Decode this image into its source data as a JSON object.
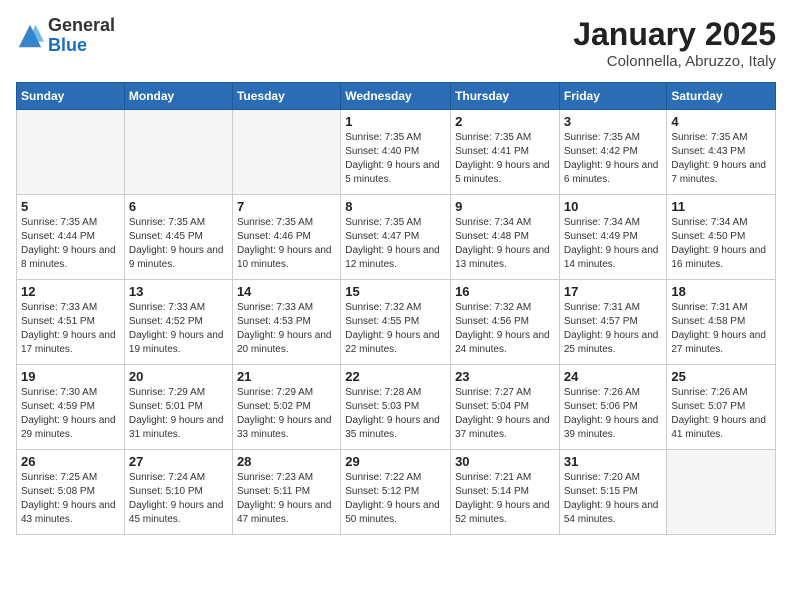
{
  "header": {
    "logo_general": "General",
    "logo_blue": "Blue",
    "month_title": "January 2025",
    "subtitle": "Colonnella, Abruzzo, Italy"
  },
  "days_of_week": [
    "Sunday",
    "Monday",
    "Tuesday",
    "Wednesday",
    "Thursday",
    "Friday",
    "Saturday"
  ],
  "weeks": [
    [
      {
        "day": "",
        "info": ""
      },
      {
        "day": "",
        "info": ""
      },
      {
        "day": "",
        "info": ""
      },
      {
        "day": "1",
        "info": "Sunrise: 7:35 AM\nSunset: 4:40 PM\nDaylight: 9 hours\nand 5 minutes."
      },
      {
        "day": "2",
        "info": "Sunrise: 7:35 AM\nSunset: 4:41 PM\nDaylight: 9 hours\nand 5 minutes."
      },
      {
        "day": "3",
        "info": "Sunrise: 7:35 AM\nSunset: 4:42 PM\nDaylight: 9 hours\nand 6 minutes."
      },
      {
        "day": "4",
        "info": "Sunrise: 7:35 AM\nSunset: 4:43 PM\nDaylight: 9 hours\nand 7 minutes."
      }
    ],
    [
      {
        "day": "5",
        "info": "Sunrise: 7:35 AM\nSunset: 4:44 PM\nDaylight: 9 hours\nand 8 minutes."
      },
      {
        "day": "6",
        "info": "Sunrise: 7:35 AM\nSunset: 4:45 PM\nDaylight: 9 hours\nand 9 minutes."
      },
      {
        "day": "7",
        "info": "Sunrise: 7:35 AM\nSunset: 4:46 PM\nDaylight: 9 hours\nand 10 minutes."
      },
      {
        "day": "8",
        "info": "Sunrise: 7:35 AM\nSunset: 4:47 PM\nDaylight: 9 hours\nand 12 minutes."
      },
      {
        "day": "9",
        "info": "Sunrise: 7:34 AM\nSunset: 4:48 PM\nDaylight: 9 hours\nand 13 minutes."
      },
      {
        "day": "10",
        "info": "Sunrise: 7:34 AM\nSunset: 4:49 PM\nDaylight: 9 hours\nand 14 minutes."
      },
      {
        "day": "11",
        "info": "Sunrise: 7:34 AM\nSunset: 4:50 PM\nDaylight: 9 hours\nand 16 minutes."
      }
    ],
    [
      {
        "day": "12",
        "info": "Sunrise: 7:33 AM\nSunset: 4:51 PM\nDaylight: 9 hours\nand 17 minutes."
      },
      {
        "day": "13",
        "info": "Sunrise: 7:33 AM\nSunset: 4:52 PM\nDaylight: 9 hours\nand 19 minutes."
      },
      {
        "day": "14",
        "info": "Sunrise: 7:33 AM\nSunset: 4:53 PM\nDaylight: 9 hours\nand 20 minutes."
      },
      {
        "day": "15",
        "info": "Sunrise: 7:32 AM\nSunset: 4:55 PM\nDaylight: 9 hours\nand 22 minutes."
      },
      {
        "day": "16",
        "info": "Sunrise: 7:32 AM\nSunset: 4:56 PM\nDaylight: 9 hours\nand 24 minutes."
      },
      {
        "day": "17",
        "info": "Sunrise: 7:31 AM\nSunset: 4:57 PM\nDaylight: 9 hours\nand 25 minutes."
      },
      {
        "day": "18",
        "info": "Sunrise: 7:31 AM\nSunset: 4:58 PM\nDaylight: 9 hours\nand 27 minutes."
      }
    ],
    [
      {
        "day": "19",
        "info": "Sunrise: 7:30 AM\nSunset: 4:59 PM\nDaylight: 9 hours\nand 29 minutes."
      },
      {
        "day": "20",
        "info": "Sunrise: 7:29 AM\nSunset: 5:01 PM\nDaylight: 9 hours\nand 31 minutes."
      },
      {
        "day": "21",
        "info": "Sunrise: 7:29 AM\nSunset: 5:02 PM\nDaylight: 9 hours\nand 33 minutes."
      },
      {
        "day": "22",
        "info": "Sunrise: 7:28 AM\nSunset: 5:03 PM\nDaylight: 9 hours\nand 35 minutes."
      },
      {
        "day": "23",
        "info": "Sunrise: 7:27 AM\nSunset: 5:04 PM\nDaylight: 9 hours\nand 37 minutes."
      },
      {
        "day": "24",
        "info": "Sunrise: 7:26 AM\nSunset: 5:06 PM\nDaylight: 9 hours\nand 39 minutes."
      },
      {
        "day": "25",
        "info": "Sunrise: 7:26 AM\nSunset: 5:07 PM\nDaylight: 9 hours\nand 41 minutes."
      }
    ],
    [
      {
        "day": "26",
        "info": "Sunrise: 7:25 AM\nSunset: 5:08 PM\nDaylight: 9 hours\nand 43 minutes."
      },
      {
        "day": "27",
        "info": "Sunrise: 7:24 AM\nSunset: 5:10 PM\nDaylight: 9 hours\nand 45 minutes."
      },
      {
        "day": "28",
        "info": "Sunrise: 7:23 AM\nSunset: 5:11 PM\nDaylight: 9 hours\nand 47 minutes."
      },
      {
        "day": "29",
        "info": "Sunrise: 7:22 AM\nSunset: 5:12 PM\nDaylight: 9 hours\nand 50 minutes."
      },
      {
        "day": "30",
        "info": "Sunrise: 7:21 AM\nSunset: 5:14 PM\nDaylight: 9 hours\nand 52 minutes."
      },
      {
        "day": "31",
        "info": "Sunrise: 7:20 AM\nSunset: 5:15 PM\nDaylight: 9 hours\nand 54 minutes."
      },
      {
        "day": "",
        "info": ""
      }
    ]
  ]
}
